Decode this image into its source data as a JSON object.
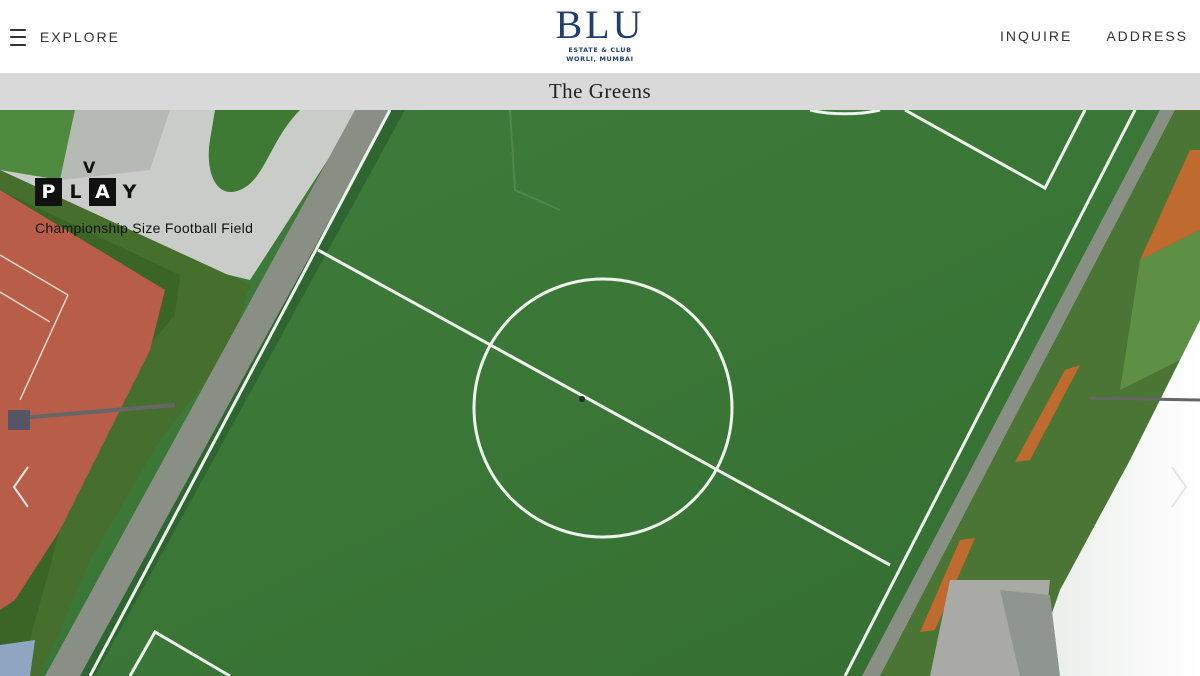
{
  "header": {
    "menu_label": "EXPLORE",
    "logo": {
      "main": "BLU",
      "sub_line1": "ESTATE & CLUB",
      "sub_line2": "WORLI, MUMBAI"
    },
    "nav": [
      "INQUIRE",
      "ADDRESS"
    ]
  },
  "section_title": "The Greens",
  "feature": {
    "badge_top": "V",
    "badge_letters": [
      "P",
      "L",
      "A",
      "Y"
    ],
    "caption": "Championship Size Football Field"
  },
  "colors": {
    "brand": "#1f3f6e",
    "titlebar_bg": "#d9d9d9",
    "turf": "#3d7a3a",
    "clay": "#b85e48"
  },
  "icons": {
    "menu": "hamburger-icon",
    "prev": "chevron-left-icon",
    "next": "chevron-right-icon"
  }
}
